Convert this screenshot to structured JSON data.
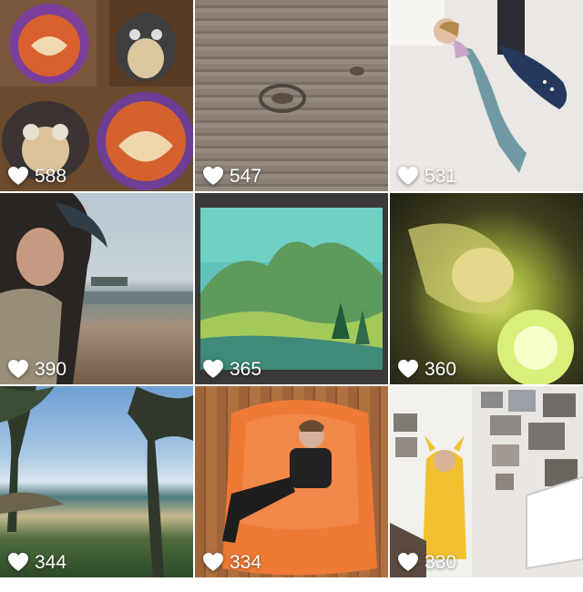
{
  "grid": {
    "tiles": [
      {
        "photo": "fox-totoro-breads",
        "likes": "588"
      },
      {
        "photo": "wood-grain",
        "likes": "547"
      },
      {
        "photo": "girl-mermaid-blanket",
        "likes": "531"
      },
      {
        "photo": "woman-seaside-selfie",
        "likes": "390"
      },
      {
        "photo": "watercolor-mountain",
        "likes": "365"
      },
      {
        "photo": "girl-glowing-lamp",
        "likes": "360"
      },
      {
        "photo": "beach-trees-view",
        "likes": "344"
      },
      {
        "photo": "boy-orange-beanbag",
        "likes": "334"
      },
      {
        "photo": "child-pikachu-costume",
        "likes": "330"
      }
    ]
  },
  "icons": {
    "like": "heart-icon"
  },
  "colors": {
    "overlay_text": "#ffffff"
  }
}
